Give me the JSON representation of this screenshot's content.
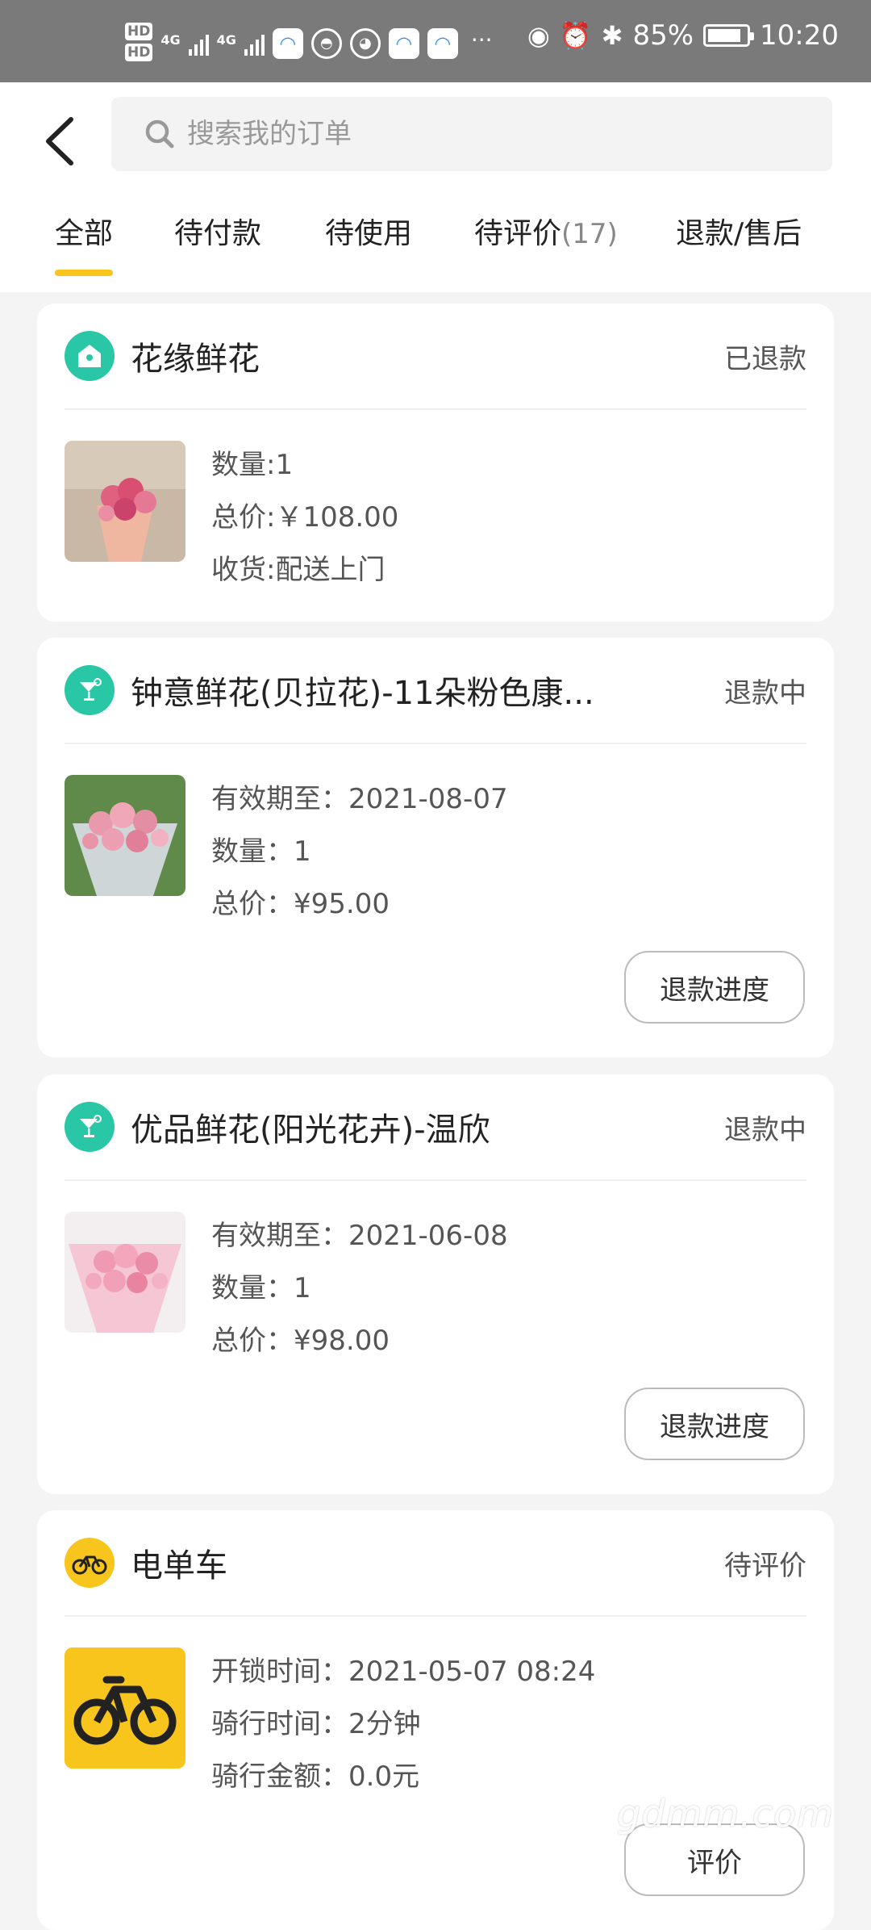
{
  "status_bar": {
    "hd1": "HD",
    "hd2": "HD",
    "net1": "4G",
    "net2": "4G",
    "more": "···",
    "battery": "85%",
    "time": "10:20"
  },
  "search": {
    "placeholder": "搜索我的订单"
  },
  "tabs": [
    {
      "label": "全部",
      "count": ""
    },
    {
      "label": "待付款",
      "count": ""
    },
    {
      "label": "待使用",
      "count": ""
    },
    {
      "label": "待评价",
      "count": "(17)"
    },
    {
      "label": "退款/售后",
      "count": ""
    }
  ],
  "orders": [
    {
      "shop": "花缘鲜花",
      "status": "已退款",
      "lines": [
        "数量:1",
        "总价:￥108.00",
        "收货:配送上门"
      ],
      "action": ""
    },
    {
      "shop": "钟意鲜花(贝拉花)-11朵粉色康...",
      "status": "退款中",
      "lines": [
        "有效期至：2021-08-07",
        "数量：1",
        "总价：¥95.00"
      ],
      "action": "退款进度"
    },
    {
      "shop": "优品鲜花(阳光花卉)-温欣",
      "status": "退款中",
      "lines": [
        "有效期至：2021-06-08",
        "数量：1",
        "总价：¥98.00"
      ],
      "action": "退款进度"
    },
    {
      "shop": "电单车",
      "status": "待评价",
      "lines": [
        "开锁时间：2021-05-07 08:24",
        "骑行时间：2分钟",
        "骑行金额：0.0元"
      ],
      "action": "评价"
    }
  ],
  "watermark": "gdmm.com",
  "colors": {
    "accent": "#f8c51c",
    "shop_icon": "#29c7a6",
    "status_bar": "#7a7a7a"
  }
}
